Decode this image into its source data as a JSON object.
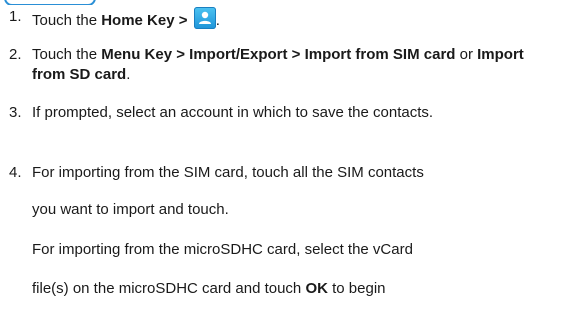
{
  "steps": [
    {
      "number": "1.",
      "parts": {
        "pre": "Touch the ",
        "bold": "Home Key > ",
        "post": "."
      },
      "icon": "contacts-app-icon"
    },
    {
      "number": "2.",
      "parts": {
        "pre": "Touch the ",
        "bold1": "Menu Key > Import/Export > Import from SIM card",
        "mid": " or ",
        "bold2": "Import from SD card",
        "post": "."
      }
    },
    {
      "number": "3.",
      "text": "If prompted, select an account in which to save the contacts."
    },
    {
      "number": "4.",
      "line1": "For importing from the SIM card, touch all the SIM contacts",
      "line2": "you want to import and touch.",
      "line3": "For importing from the microSDHC card, select the vCard",
      "line4_pre": "file(s) on the microSDHC card and touch ",
      "line4_bold": "OK",
      "line4_post": " to begin"
    }
  ],
  "colors": {
    "accent": "#2a8fd6",
    "text": "#1a1a1a",
    "icon_top": "#4cc3f2",
    "icon_bottom": "#1f94d8"
  }
}
